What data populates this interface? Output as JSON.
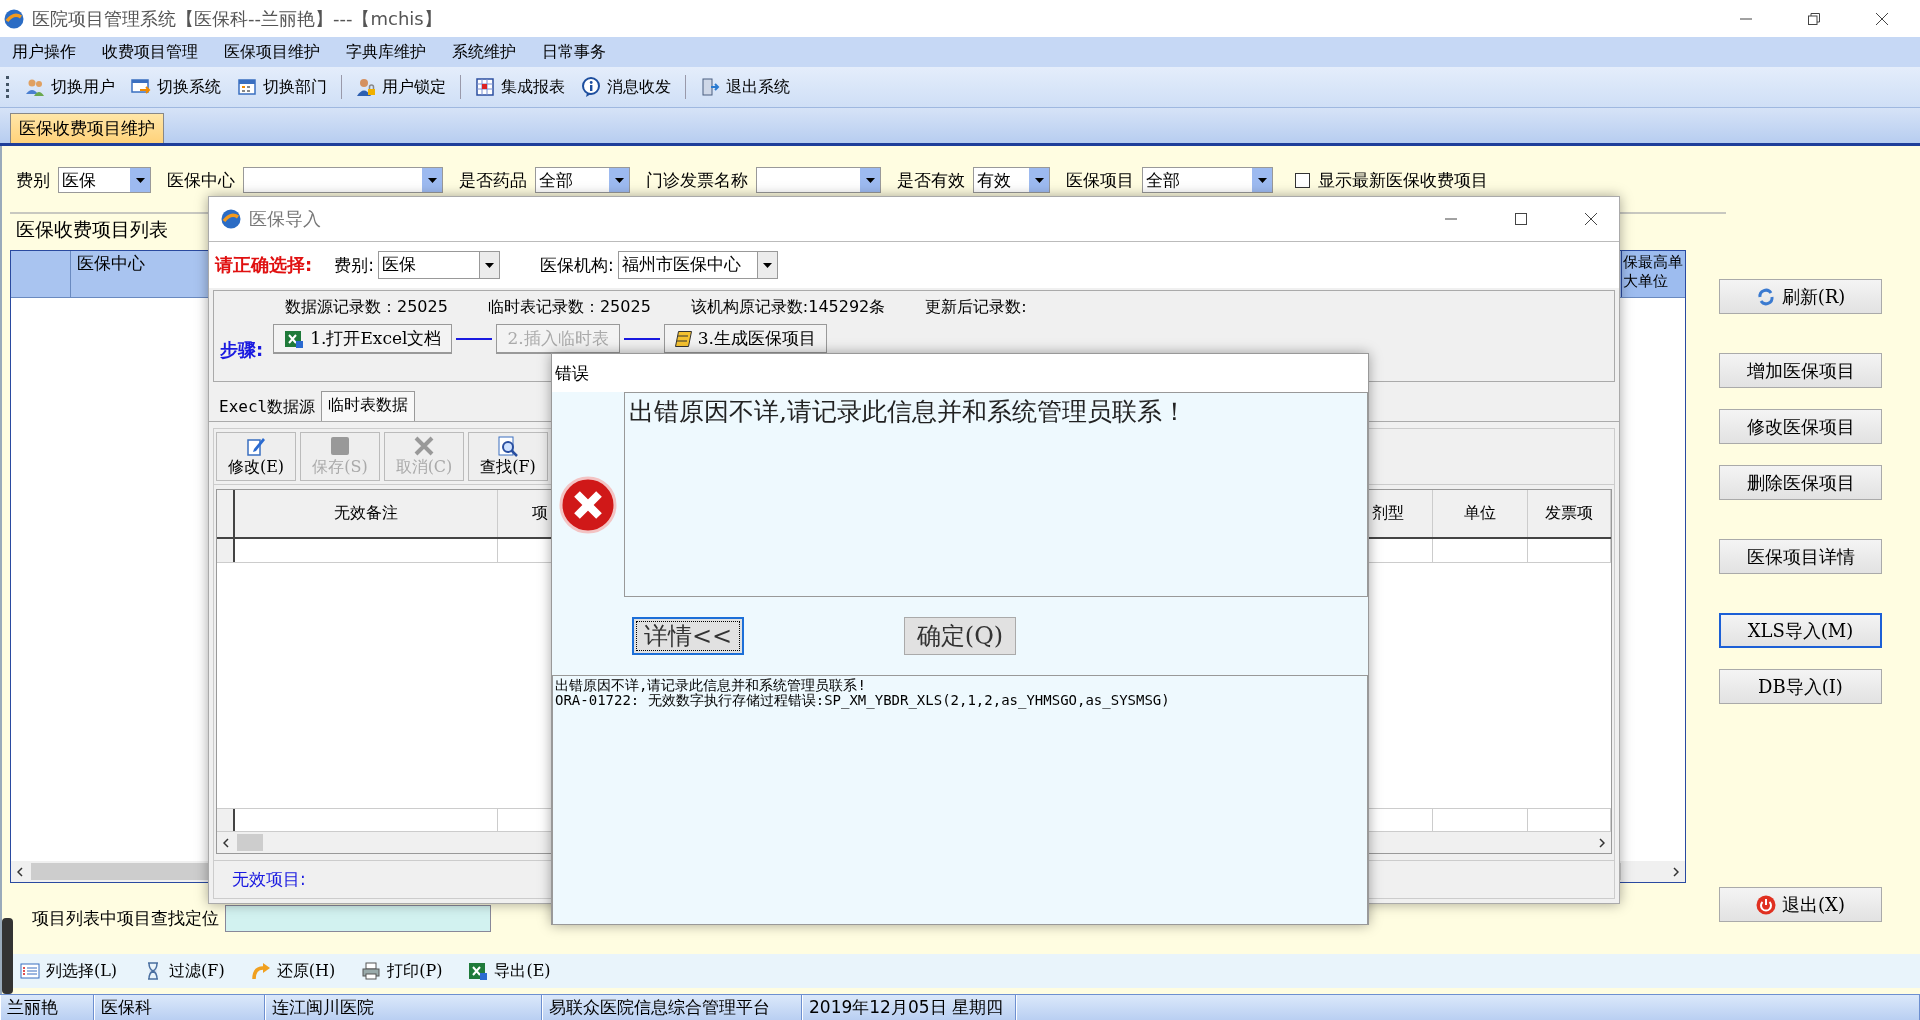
{
  "window": {
    "title": "医院项目管理系统【医保科--兰丽艳】---【mchis】"
  },
  "menu": [
    "用户操作",
    "收费项目管理",
    "医保项目维护",
    "字典库维护",
    "系统维护",
    "日常事务"
  ],
  "toolbar": [
    [
      "切换用户",
      "切换系统",
      "切换部门"
    ],
    [
      "用户锁定"
    ],
    [
      "集成报表",
      "消息收发"
    ],
    [
      "退出系统"
    ]
  ],
  "tabs": [
    {
      "label": "医保收费项目维护",
      "selected": true
    }
  ],
  "filters": [
    {
      "kind": "select",
      "label": "费别",
      "value": "医保"
    },
    {
      "kind": "select",
      "label": "医保中心"
    },
    {
      "kind": "select",
      "label": "是否药品",
      "value": "全部"
    },
    {
      "kind": "select",
      "label": "门诊发票名称"
    },
    {
      "kind": "select",
      "label": "是否有效",
      "value": "有效"
    },
    {
      "kind": "select",
      "label": "医保项目",
      "value": "全部"
    },
    {
      "kind": "checkbox",
      "label": "显示最新医保收费项目",
      "checked": false
    }
  ],
  "item_list": {
    "title": "医保收费项目列表",
    "columns": [
      {
        "lines": [
          "医保中心"
        ]
      },
      {
        "lines": [
          "保最高单",
          "大单位"
        ]
      }
    ],
    "search_label": "项目列表中项目查找定位"
  },
  "side_buttons": [
    [
      {
        "label": "刷新(R)",
        "focused": false
      }
    ],
    [
      {
        "label": "增加医保项目",
        "focused": false
      },
      {
        "label": "修改医保项目",
        "focused": false
      },
      {
        "label": "删除医保项目",
        "focused": false
      }
    ],
    [
      {
        "label": "医保项目详情",
        "focused": false
      }
    ],
    [
      {
        "label": "XLS导入(M)",
        "focused": true
      },
      {
        "label": "DB导入(I)",
        "focused": false
      }
    ],
    [
      {
        "label": "退出(X)",
        "focused": false
      }
    ]
  ],
  "bottom_toolbar": [
    "列选择(L)",
    "过滤(F)",
    "还原(H)",
    "打印(P)",
    "导出(E)"
  ],
  "status_bar": [
    "兰丽艳",
    "医保科",
    "连江闽川医院",
    "易联众医院信息综合管理平台",
    "2019年12月05日 星期四"
  ],
  "import_dialog": {
    "title": "医保导入",
    "prompt": "请正确选择:",
    "fee_label": "费别:",
    "fee_value": "医保",
    "org_label": "医保机构:",
    "org_value": "福州市医保中心",
    "counts": [
      "数据源记录数：25025",
      "临时表记录数：25025",
      "该机构原记录数:145292条",
      "更新后记录数:"
    ],
    "steps_label": "步骤:",
    "steps": [
      {
        "label": "1.打开Excel文档",
        "disabled": false
      },
      {
        "label": "2.插入临时表",
        "disabled": true
      },
      {
        "label": "3.生成医保项目",
        "disabled": false
      }
    ],
    "tabs": [
      {
        "label": "Execl数据源",
        "selected": false
      },
      {
        "label": "临时表数据",
        "selected": true
      }
    ],
    "actions": [
      {
        "label": "修改(E)",
        "disabled": false
      },
      {
        "label": "保存(S)",
        "disabled": true
      },
      {
        "label": "取消(C)",
        "disabled": true
      },
      {
        "label": "查找(F)",
        "disabled": false
      }
    ],
    "columns": [
      "无效备注",
      "项",
      "剂型",
      "单位",
      "发票项"
    ],
    "invalid_label": "无效项目:"
  },
  "error_dialog": {
    "title": "错误",
    "message": "出错原因不详,请记录此信息并和系统管理员联系！",
    "buttons": [
      {
        "label": "详情<<",
        "focused": true
      },
      {
        "label": "确定(Q)",
        "focused": false
      }
    ],
    "details": [
      "出错原因不详,请记录此信息并和系统管理员联系!",
      "ORA-01722: 无效数字执行存储过程错误:SP_XM_YBDR_XLS(2,1,2,as_YHMSGO,as_SYSMSG)"
    ]
  }
}
